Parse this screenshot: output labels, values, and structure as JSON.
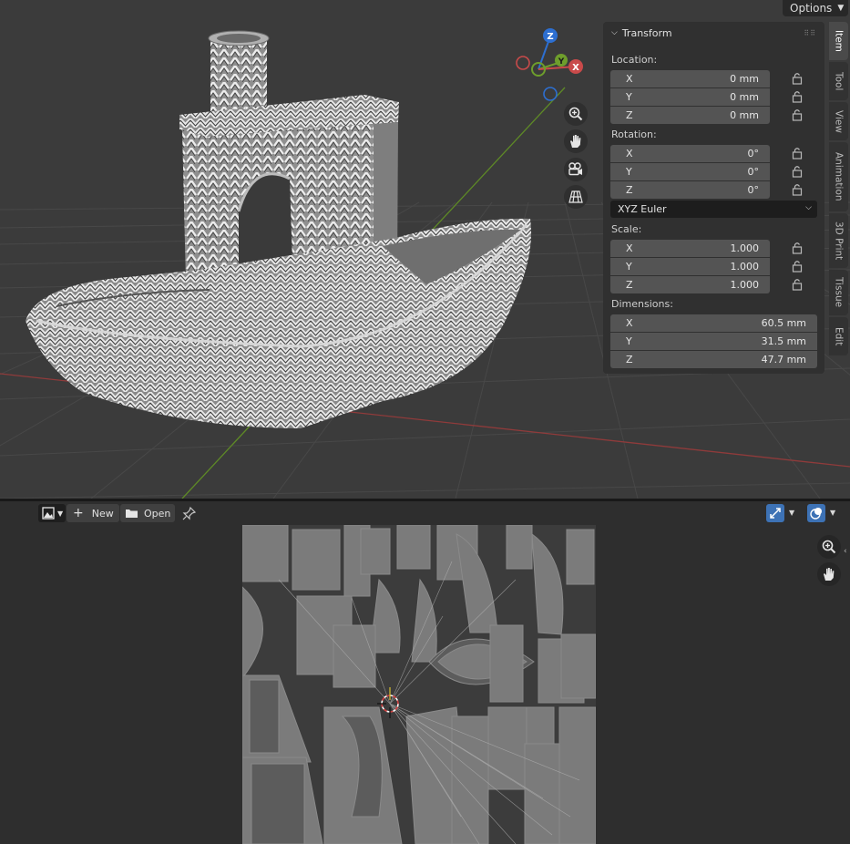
{
  "viewport": {
    "options_label": "Options",
    "gizmo": {
      "z": "Z",
      "y": "Y",
      "x": "X"
    },
    "nav_icons": [
      "zoom-icon",
      "hand-pan-icon",
      "camera-icon",
      "perspective-grid-icon"
    ]
  },
  "npanel": {
    "title": "Transform",
    "location": {
      "label": "Location:",
      "x_label": "X",
      "x": "0 mm",
      "y_label": "Y",
      "y": "0 mm",
      "z_label": "Z",
      "z": "0 mm"
    },
    "rotation": {
      "label": "Rotation:",
      "x_label": "X",
      "x": "0°",
      "y_label": "Y",
      "y": "0°",
      "z_label": "Z",
      "z": "0°",
      "mode": "XYZ Euler"
    },
    "scale": {
      "label": "Scale:",
      "x_label": "X",
      "x": "1.000",
      "y_label": "Y",
      "y": "1.000",
      "z_label": "Z",
      "z": "1.000"
    },
    "dimensions": {
      "label": "Dimensions:",
      "x_label": "X",
      "x": "60.5 mm",
      "y_label": "Y",
      "y": "31.5 mm",
      "z_label": "Z",
      "z": "47.7 mm"
    }
  },
  "tabs": [
    "Item",
    "Tool",
    "View",
    "Animation",
    "3D Print",
    "Tissue",
    "Edit"
  ],
  "uv_editor": {
    "new_label": "New",
    "open_label": "Open"
  },
  "colors": {
    "axis_x": "#c94a4a",
    "axis_y": "#6e9e2c",
    "axis_z": "#2d6fd1",
    "active_button": "#3d72b5"
  }
}
